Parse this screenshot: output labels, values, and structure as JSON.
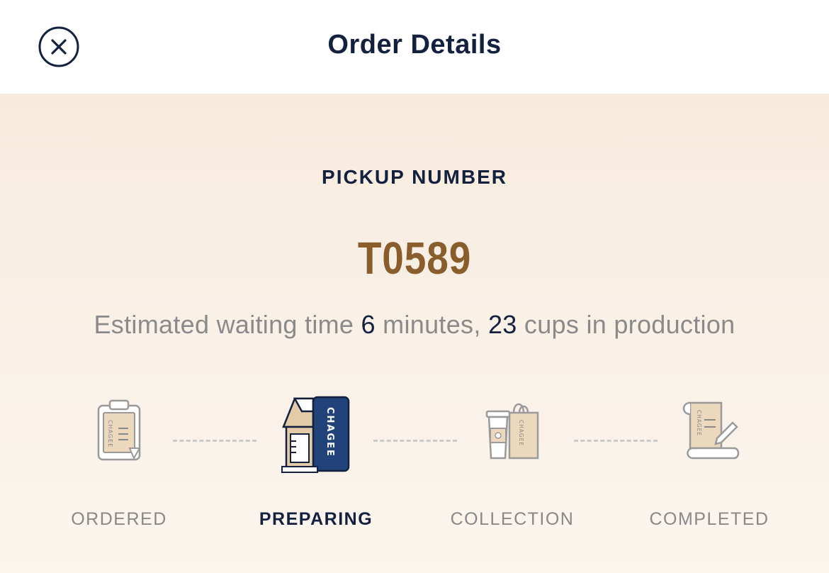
{
  "header": {
    "title": "Order Details",
    "close_icon": "close-icon"
  },
  "pickup": {
    "label": "PICKUP NUMBER",
    "number": "T0589"
  },
  "waiting": {
    "prefix": "Estimated waiting time ",
    "minutes": "6",
    "middle": " minutes, ",
    "cups": "23",
    "suffix": " cups in production"
  },
  "steps": [
    {
      "label": "ORDERED",
      "icon": "clipboard-icon",
      "active": false
    },
    {
      "label": "PREPARING",
      "icon": "tea-machine-icon",
      "active": true
    },
    {
      "label": "COLLECTION",
      "icon": "cup-and-bag-icon",
      "active": false
    },
    {
      "label": "COMPLETED",
      "icon": "receipt-scroll-icon",
      "active": false
    }
  ],
  "brand_text": "CHAGEE",
  "colors": {
    "navy": "#13213f",
    "brand_brown": "#8a5e2c",
    "muted_gray": "#888888",
    "accent_blue": "#22427a",
    "beige": "#e9d7be"
  }
}
